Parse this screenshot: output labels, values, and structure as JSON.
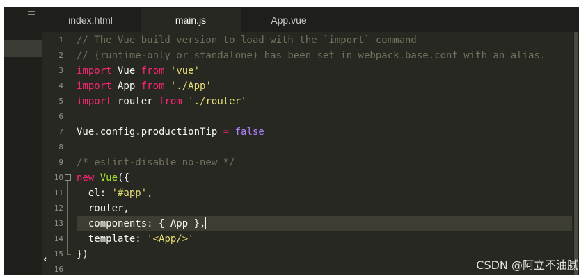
{
  "sidebar": {
    "menu_icon": "hamburger-icon",
    "collapse_glyph": "‹"
  },
  "tabs": [
    {
      "label": "index.html",
      "active": false
    },
    {
      "label": "main.js",
      "active": true
    },
    {
      "label": "App.vue",
      "active": false
    }
  ],
  "editor": {
    "current_line": 13,
    "lines": [
      {
        "n": "1",
        "tokens": [
          {
            "t": "// The Vue build version to load with the `import` command",
            "c": "cmt"
          }
        ]
      },
      {
        "n": "2",
        "tokens": [
          {
            "t": "// (runtime-only or standalone) has been set in webpack.base.conf with an alias.",
            "c": "cmt"
          }
        ]
      },
      {
        "n": "3",
        "tokens": [
          {
            "t": "import",
            "c": "kw"
          },
          {
            "t": " Vue ",
            "c": ""
          },
          {
            "t": "from",
            "c": "kw"
          },
          {
            "t": " ",
            "c": ""
          },
          {
            "t": "'vue'",
            "c": "str"
          }
        ]
      },
      {
        "n": "4",
        "tokens": [
          {
            "t": "import",
            "c": "kw"
          },
          {
            "t": " App ",
            "c": ""
          },
          {
            "t": "from",
            "c": "kw"
          },
          {
            "t": " ",
            "c": ""
          },
          {
            "t": "'./App'",
            "c": "str"
          }
        ]
      },
      {
        "n": "5",
        "tokens": [
          {
            "t": "import",
            "c": "kw"
          },
          {
            "t": " router ",
            "c": ""
          },
          {
            "t": "from",
            "c": "kw"
          },
          {
            "t": " ",
            "c": ""
          },
          {
            "t": "'./router'",
            "c": "str"
          }
        ]
      },
      {
        "n": "6",
        "tokens": []
      },
      {
        "n": "7",
        "tokens": [
          {
            "t": "Vue.config.productionTip ",
            "c": ""
          },
          {
            "t": "=",
            "c": "kw"
          },
          {
            "t": " ",
            "c": ""
          },
          {
            "t": "false",
            "c": "num"
          }
        ]
      },
      {
        "n": "8",
        "tokens": []
      },
      {
        "n": "9",
        "tokens": [
          {
            "t": "/* eslint-disable no-new */",
            "c": "cmt"
          }
        ]
      },
      {
        "n": "10",
        "tokens": [
          {
            "t": "new",
            "c": "kw"
          },
          {
            "t": " ",
            "c": ""
          },
          {
            "t": "Vue",
            "c": "cls"
          },
          {
            "t": "({",
            "c": ""
          }
        ]
      },
      {
        "n": "11",
        "tokens": [
          {
            "t": "  el: ",
            "c": ""
          },
          {
            "t": "'#app'",
            "c": "str"
          },
          {
            "t": ",",
            "c": ""
          }
        ]
      },
      {
        "n": "12",
        "tokens": [
          {
            "t": "  router,",
            "c": ""
          }
        ]
      },
      {
        "n": "13",
        "tokens": [
          {
            "t": "  components: { App },",
            "c": ""
          }
        ],
        "cursor": true
      },
      {
        "n": "14",
        "tokens": [
          {
            "t": "  template: ",
            "c": ""
          },
          {
            "t": "'<App/>'",
            "c": "str"
          }
        ]
      },
      {
        "n": "15",
        "tokens": [
          {
            "t": "})",
            "c": ""
          }
        ]
      },
      {
        "n": "16",
        "tokens": []
      }
    ]
  },
  "watermark": "CSDN @阿立不油腻",
  "colors": {
    "background": "#272822",
    "comment": "#75715e",
    "keyword": "#f92672",
    "string": "#e6db74",
    "class": "#a6e22e",
    "constant": "#ae81ff"
  }
}
